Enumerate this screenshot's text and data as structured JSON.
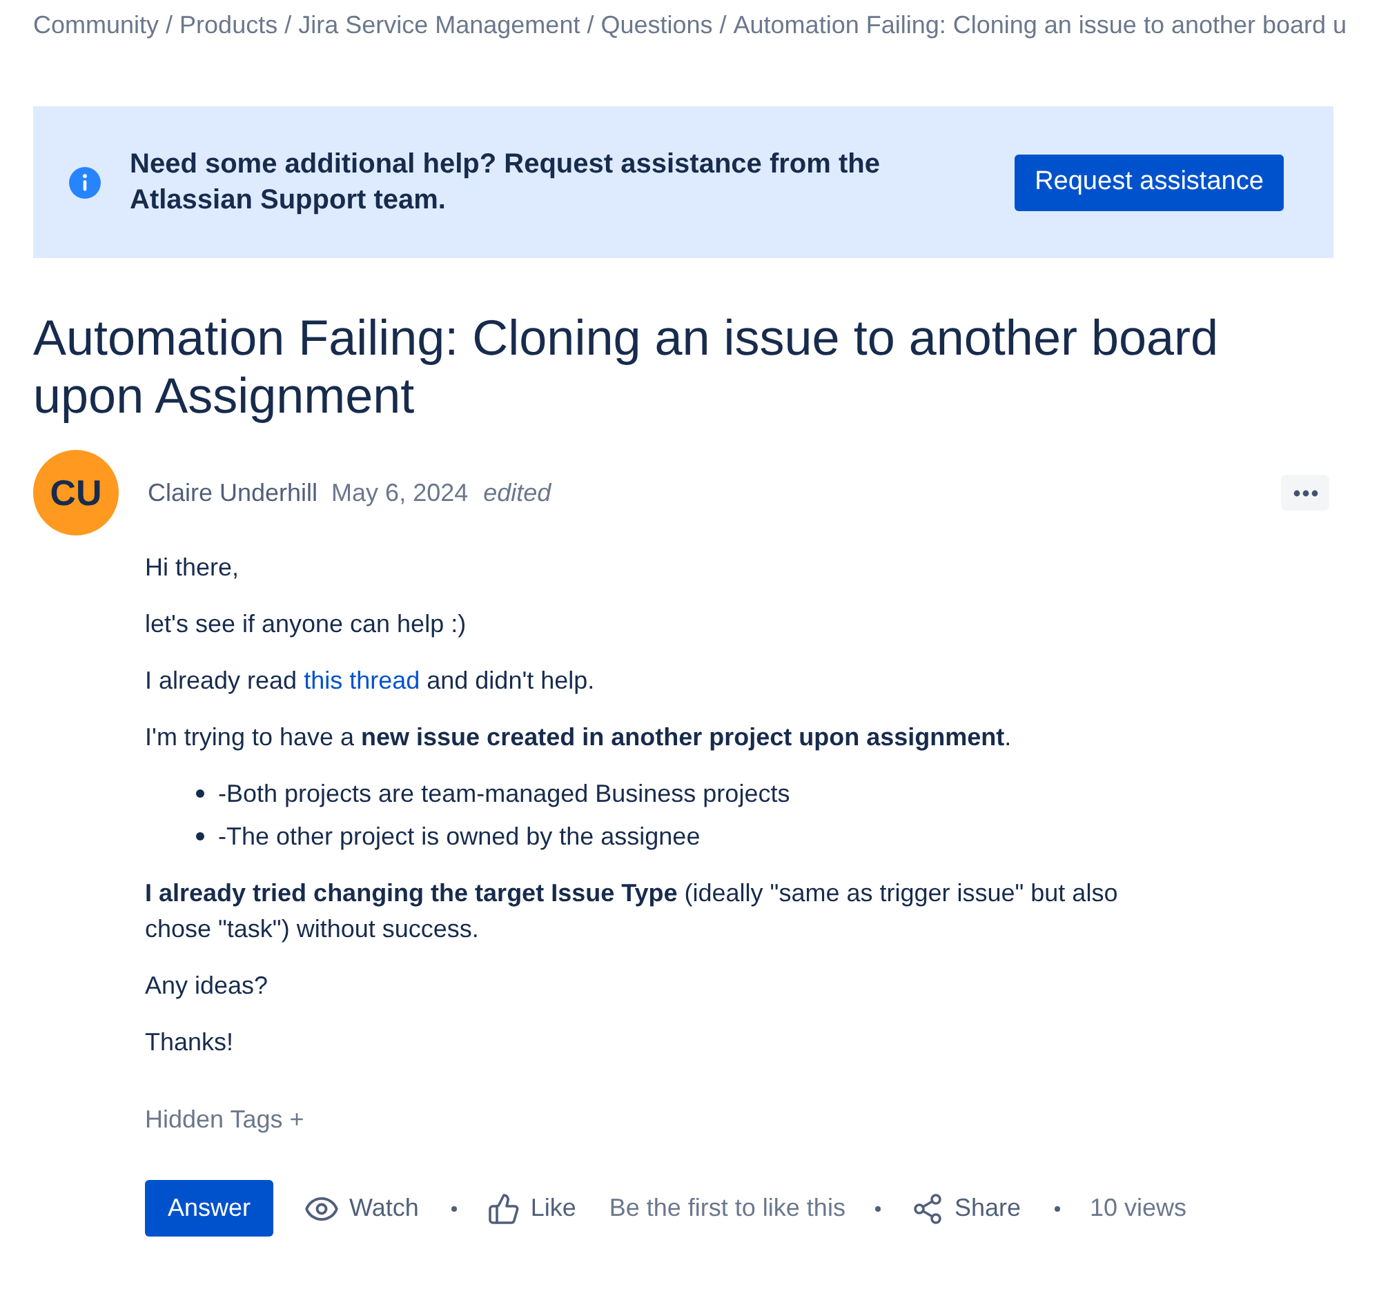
{
  "breadcrumb": {
    "separator": "/",
    "items": [
      "Community",
      "Products",
      "Jira Service Management",
      "Questions",
      "Automation Failing: Cloning an issue to another board u"
    ]
  },
  "banner": {
    "message": "Need some additional help? Request assistance from the Atlassian Support team.",
    "button": "Request assistance"
  },
  "title": "Automation Failing: Cloning an issue to another board upon Assignment",
  "post": {
    "initials": "CU",
    "author": "Claire Underhill",
    "date": "May 6, 2024",
    "edited_label": "edited"
  },
  "body": [
    {
      "kind": "paragraph",
      "text": "Hi there,"
    },
    {
      "kind": "paragraph",
      "text": "let's see if anyone can help :)"
    },
    {
      "kind": "link_paragraph",
      "before": "I already read ",
      "link": "this thread",
      "after": " and didn't help."
    },
    {
      "kind": "paragraph",
      "text": "I'm trying to have a **new issue created in another project upon assignment**."
    },
    {
      "kind": "bullets",
      "items": [
        "-Both projects are team-managed Business projects",
        "-The other project is owned by the assignee"
      ]
    },
    {
      "kind": "paragraph",
      "text": "**I already tried changing the target Issue Type** (ideally \"same as trigger issue\" but also chose \"task\") without success."
    },
    {
      "kind": "paragraph",
      "text": "Any ideas?"
    },
    {
      "kind": "paragraph",
      "text": "Thanks!"
    }
  ],
  "hidden_tags": "Hidden Tags +",
  "actions": [
    {
      "kind": "primary",
      "label": "Answer"
    },
    {
      "kind": "watch",
      "label": "Watch"
    },
    {
      "kind": "separator"
    },
    {
      "kind": "like",
      "label": "Like"
    },
    {
      "kind": "note",
      "text": "Be the first to like this"
    },
    {
      "kind": "separator"
    },
    {
      "kind": "share",
      "label": "Share"
    },
    {
      "kind": "separator"
    },
    {
      "kind": "note",
      "text": "10 views"
    }
  ]
}
